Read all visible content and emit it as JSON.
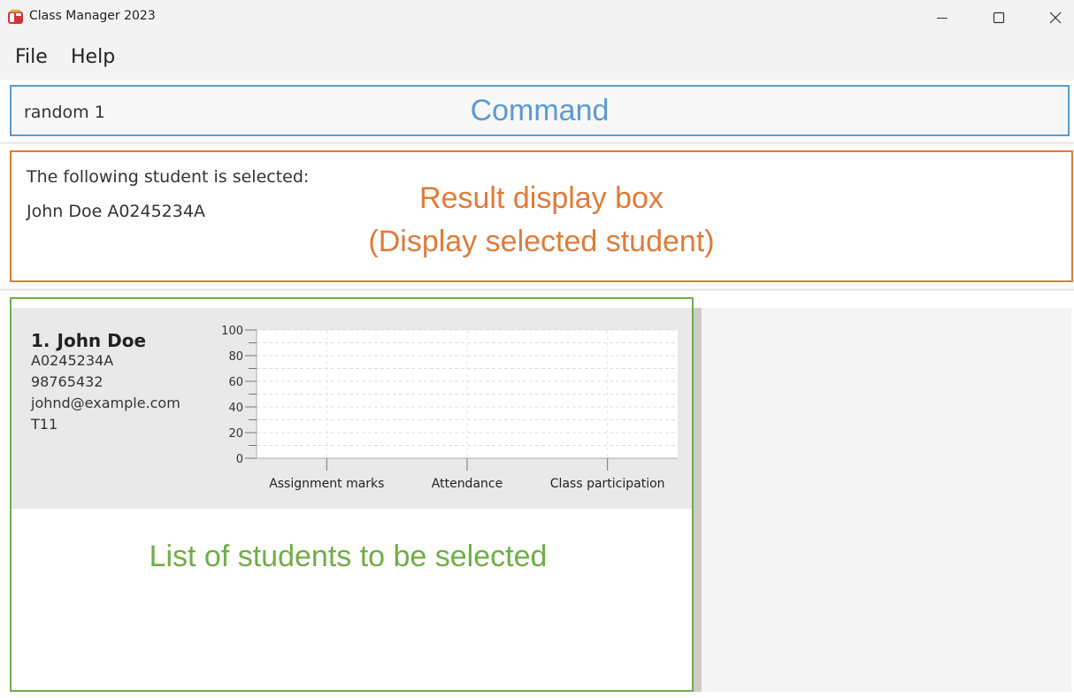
{
  "window": {
    "title": "Class Manager 2023",
    "icon": "class-manager-app-icon",
    "controls": [
      "minimize-icon",
      "maximize-icon",
      "close-icon"
    ]
  },
  "menu": {
    "items": [
      {
        "label": "File"
      },
      {
        "label": "Help"
      }
    ]
  },
  "command": {
    "value": "random 1",
    "annotation": "Command"
  },
  "result": {
    "lines": [
      "The following student is selected:",
      "John Doe A0245234A"
    ],
    "annotation_line1": "Result display box",
    "annotation_line2": "(Display selected student)"
  },
  "student_list": {
    "annotation": "List of students to be selected",
    "students": [
      {
        "index": "1.",
        "name": "John Doe",
        "student_number": "A0245234A",
        "phone": "98765432",
        "email": "johnd@example.com",
        "tutorial": "T11"
      }
    ]
  },
  "colors": {
    "command_accent": "#5b9bd5",
    "result_accent": "#e07b39",
    "list_accent": "#70ad47",
    "card_background": "#e9e9e9"
  },
  "chart_data": {
    "type": "bar",
    "categories": [
      "Assignment marks",
      "Attendance",
      "Class participation"
    ],
    "values": [
      0,
      0,
      0
    ],
    "ylim": [
      0,
      100
    ],
    "yticks": [
      0,
      20,
      40,
      60,
      80,
      100
    ],
    "grid": true
  }
}
